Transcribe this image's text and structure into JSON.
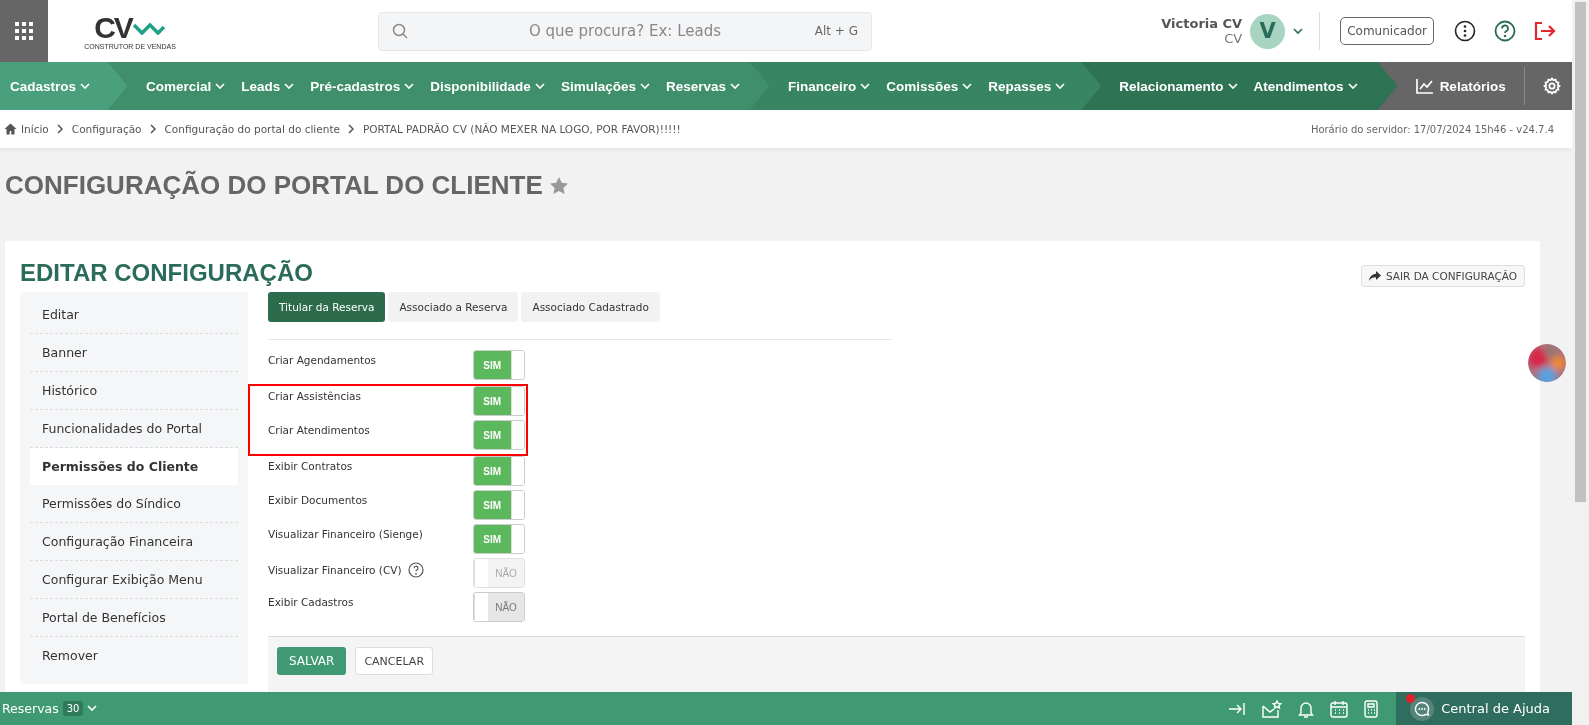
{
  "top_bar": {
    "logo": {
      "mark": "CV",
      "tagline": "CONSTRUTOR DE VENDAS"
    },
    "search": {
      "placeholder": "O que procura? Ex: Leads",
      "shortcut": "Alt + G"
    },
    "user": {
      "name": "Victoria CV",
      "role": "CV",
      "initial": "V"
    },
    "communicator_button": "Comunicador"
  },
  "nav": {
    "groups": [
      {
        "items": [
          "Cadastros"
        ]
      },
      {
        "items": [
          "Comercial",
          "Leads",
          "Pré-cadastros",
          "Disponibilidade",
          "Simulações",
          "Reservas"
        ]
      },
      {
        "items": [
          "Financeiro",
          "Comissões",
          "Repasses"
        ]
      },
      {
        "items": [
          "Relacionamento",
          "Atendimentos"
        ]
      }
    ],
    "reports": "Relatórios"
  },
  "breadcrumb": {
    "items": [
      "Início",
      "Configuração",
      "Configuração do portal do cliente",
      "PORTAL PADRÃO CV (NÃO MEXER NA LOGO, POR FAVOR)!!!!!"
    ],
    "server_time": "Horário do servidor: 17/07/2024 15h46 - v24.7.4"
  },
  "page": {
    "title": "CONFIGURAÇÃO DO PORTAL DO CLIENTE",
    "favorite": false
  },
  "card": {
    "title": "EDITAR CONFIGURAÇÃO",
    "exit_button": "SAIR DA CONFIGURAÇÃO",
    "sidebar": [
      {
        "label": "Editar",
        "selected": false
      },
      {
        "label": "Banner",
        "selected": false
      },
      {
        "label": "Histórico",
        "selected": false
      },
      {
        "label": "Funcionalidades do Portal",
        "selected": false
      },
      {
        "label": "Permissões do Cliente",
        "selected": true
      },
      {
        "label": "Permissões do Síndico",
        "selected": false
      },
      {
        "label": "Configuração Financeira",
        "selected": false
      },
      {
        "label": "Configurar Exibição Menu",
        "selected": false
      },
      {
        "label": "Portal de Benefícios",
        "selected": false
      },
      {
        "label": "Remover",
        "selected": false
      }
    ],
    "tabs": [
      {
        "label": "Titular da Reserva",
        "selected": true
      },
      {
        "label": "Associado a Reserva",
        "selected": false
      },
      {
        "label": "Associado Cadastrado",
        "selected": false
      }
    ],
    "permissions": [
      {
        "label": "Criar Agendamentos",
        "on": true,
        "state_label": "SIM",
        "disabled": false,
        "help": false,
        "highlighted": false
      },
      {
        "label": "Criar Assistências",
        "on": true,
        "state_label": "SIM",
        "disabled": false,
        "help": false,
        "highlighted": true
      },
      {
        "label": "Criar Atendimentos",
        "on": true,
        "state_label": "SIM",
        "disabled": false,
        "help": false,
        "highlighted": true
      },
      {
        "label": "Exibir Contratos",
        "on": true,
        "state_label": "SIM",
        "disabled": false,
        "help": false,
        "highlighted": false
      },
      {
        "label": "Exibir Documentos",
        "on": true,
        "state_label": "SIM",
        "disabled": false,
        "help": false,
        "highlighted": false
      },
      {
        "label": "Visualizar Financeiro (Sienge)",
        "on": true,
        "state_label": "SIM",
        "disabled": false,
        "help": false,
        "highlighted": false
      },
      {
        "label": "Visualizar Financeiro (CV)",
        "on": false,
        "state_label": "NÃO",
        "disabled": true,
        "help": true,
        "highlighted": false
      },
      {
        "label": "Exibir Cadastros",
        "on": false,
        "state_label": "NÃO",
        "disabled": false,
        "help": false,
        "highlighted": false
      }
    ],
    "actions": {
      "save": "SALVAR",
      "cancel": "CANCELAR"
    }
  },
  "bottom_bar": {
    "module": "Reservas",
    "count": "30",
    "help_center": "Central de Ajuda",
    "help_unread": true
  }
}
